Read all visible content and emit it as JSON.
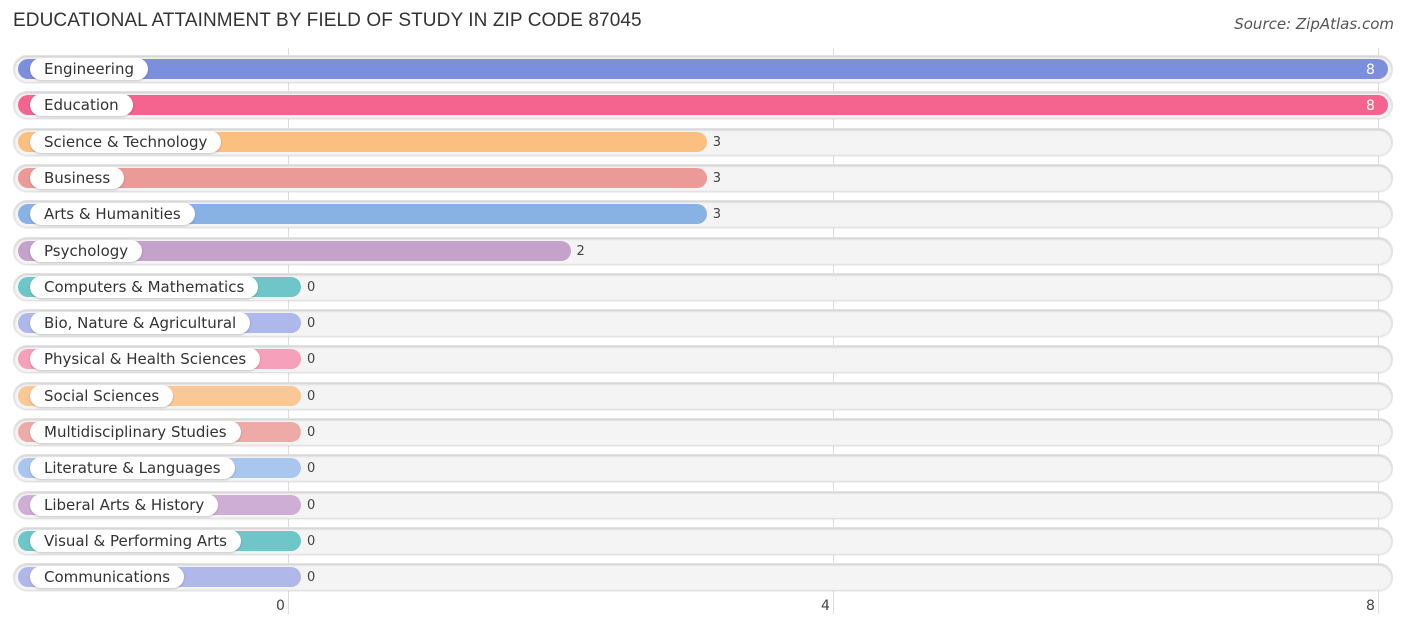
{
  "header": {
    "title": "EDUCATIONAL ATTAINMENT BY FIELD OF STUDY IN ZIP CODE 87045",
    "source": "Source: ZipAtlas.com"
  },
  "chart_data": {
    "type": "bar",
    "orientation": "horizontal",
    "title": "EDUCATIONAL ATTAINMENT BY FIELD OF STUDY IN ZIP CODE 87045",
    "xlabel": "",
    "ylabel": "",
    "xlim": [
      0,
      8
    ],
    "x_ticks": [
      "0",
      "4",
      "8"
    ],
    "grid": true,
    "categories": [
      "Engineering",
      "Education",
      "Science & Technology",
      "Business",
      "Arts & Humanities",
      "Psychology",
      "Computers & Mathematics",
      "Bio, Nature & Agricultural",
      "Physical & Health Sciences",
      "Social Sciences",
      "Multidisciplinary Studies",
      "Literature & Languages",
      "Liberal Arts & History",
      "Visual & Performing Arts",
      "Communications"
    ],
    "values": [
      8,
      8,
      3,
      3,
      3,
      2,
      0,
      0,
      0,
      0,
      0,
      0,
      0,
      0,
      0
    ],
    "colors": [
      "#7b8fdc",
      "#f4648f",
      "#fbbf80",
      "#ec9a98",
      "#88b2e4",
      "#c4a2cb",
      "#6ec6c8",
      "#aeb8eb",
      "#f6a0bb",
      "#fbc795",
      "#eeaaa7",
      "#a9c6ee",
      "#cfaed6",
      "#6ec6c8",
      "#b0b8ea"
    ]
  }
}
